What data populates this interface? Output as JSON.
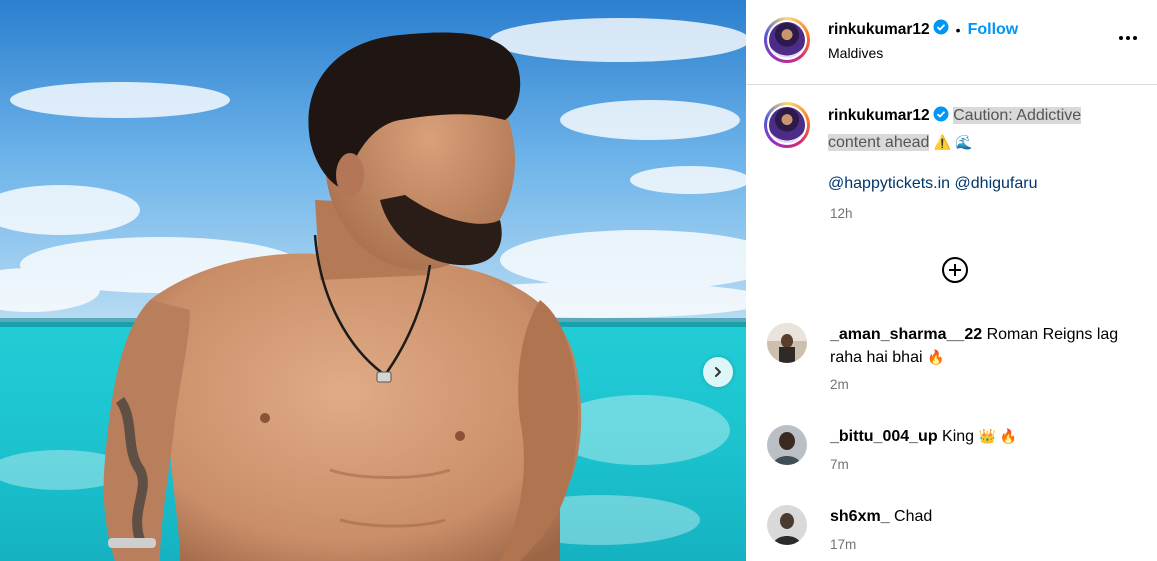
{
  "post": {
    "username": "rinkukumar12",
    "follow_label": "Follow",
    "separator": "•",
    "location": "Maldives",
    "caption_highlight": "Caution: Addictive content ahead",
    "caption_emojis": "⚠️ 🌊",
    "mentions": [
      "@happytickets.in",
      "@dhigufaru"
    ],
    "time": "12h"
  },
  "comments": [
    {
      "username": "_aman_sharma__22",
      "text": "Roman Reigns lag raha hai bhai",
      "emoji": "🔥",
      "time": "2m"
    },
    {
      "username": "_bittu_004_up",
      "text": "King",
      "emoji": "👑 🔥",
      "time": "7m"
    },
    {
      "username": "sh6xm_",
      "text": "Chad",
      "emoji": "",
      "time": "17m"
    }
  ],
  "colors": {
    "accent": "#0095f6",
    "mention": "#00376b",
    "muted": "#737373",
    "verified": "#0095f6"
  },
  "icons": [
    "verified-badge-icon",
    "more-options-icon",
    "add-comment-icon",
    "chevron-right-icon",
    "warning-emoji",
    "wave-emoji",
    "fire-emoji",
    "crown-emoji"
  ]
}
